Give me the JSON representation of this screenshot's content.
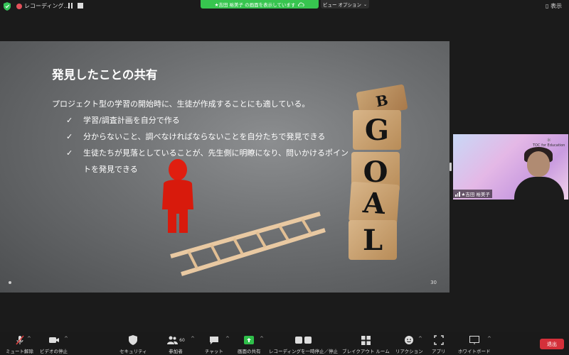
{
  "topbar": {
    "recording_label": "レコーディング...",
    "sharing_banner": "★吉田 裕美子 の画面を表示しています",
    "view_options": "ビュー オプション",
    "display_label": "表示"
  },
  "slide": {
    "title": "発見したことの共有",
    "intro": "プロジェクト型の学習の開始時に、生徒が作成することにも適している。",
    "bullets": [
      "学習/調査計画を自分で作る",
      "分からないこと、調べなければならないことを自分たちで発見できる",
      "生徒たちが見落としていることが、先生側に明瞭になり、問いかけるポイントを発見できる"
    ],
    "check_glyph": "✓",
    "page_number": "30",
    "goal_blocks": [
      "B",
      "G",
      "O",
      "A",
      "L"
    ]
  },
  "self_view": {
    "name": "★吉田 裕美子",
    "logo_text": "TOC for Education"
  },
  "toolbar": {
    "mute": "ミュート解除",
    "video": "ビデオの停止",
    "security": "セキュリティ",
    "participants": "参加者",
    "participants_count": "60",
    "chat": "チャット",
    "share": "画面の共有",
    "record": "レコーディングを一時停止／停止",
    "breakout": "ブレイクアウト ルーム",
    "reactions": "リアクション",
    "apps": "アプリ",
    "whiteboard": "ホワイトボード",
    "end": "退出"
  },
  "colors": {
    "sharing_green": "#37c54f",
    "end_red": "#d4303a",
    "share_icon_green": "#2fbf4a"
  }
}
